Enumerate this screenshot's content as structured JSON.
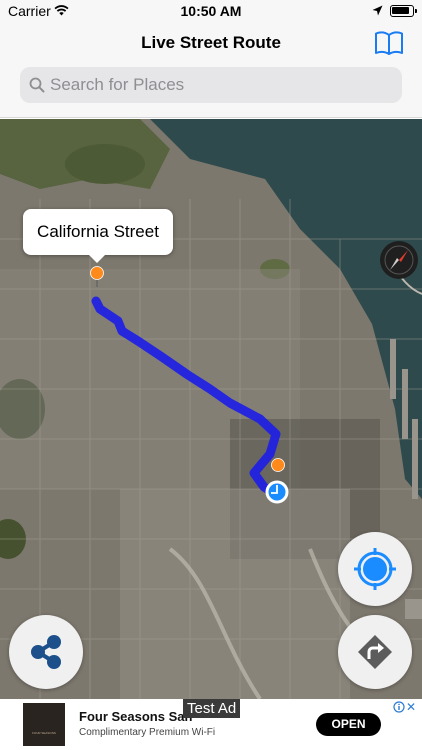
{
  "status_bar": {
    "carrier": "Carrier",
    "time": "10:50 AM",
    "icons": [
      "wifi-icon",
      "location-arrow-icon",
      "battery-icon"
    ]
  },
  "nav": {
    "title": "Live Street Route",
    "right_icon": "book-icon"
  },
  "search": {
    "placeholder": "Search for Places",
    "icon": "search-icon"
  },
  "map": {
    "callout_label": "California Street",
    "view": "satellite",
    "colors": {
      "route": "#1e1ee6",
      "pin": "#ff8a1c",
      "user_location": "#1a8cff"
    },
    "buttons": {
      "locate": "crosshair-icon",
      "directions": "directions-icon",
      "share": "share-icon",
      "compass": "compass-icon"
    }
  },
  "ad": {
    "badge": "Test Ad",
    "title": "Four Seasons San",
    "subtitle": "Complimentary Premium Wi-Fi",
    "logo_text": "FOUR SEASONS",
    "cta": "OPEN",
    "icons": [
      "adchoices-icon",
      "close-icon"
    ]
  }
}
